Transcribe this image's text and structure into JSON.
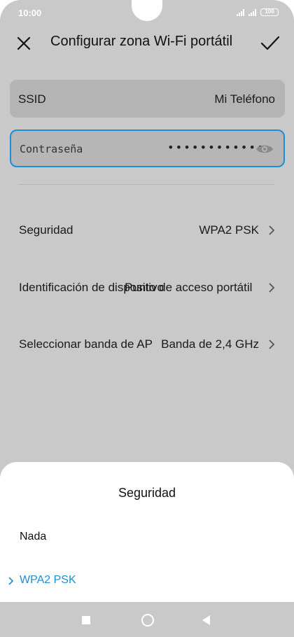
{
  "status": {
    "time": "10:00",
    "battery": "100"
  },
  "header": {
    "title": "Configurar zona Wi-Fi portátil",
    "close_icon": "close-icon",
    "confirm_icon": "check-icon"
  },
  "fields": {
    "ssid_label": "SSID",
    "ssid_value": "Mi Teléfono",
    "password_label": "Contraseña",
    "password_mask": "••••••••••••"
  },
  "rows": [
    {
      "label": "Seguridad",
      "value": "WPA2 PSK"
    },
    {
      "label": "Identificación de dispositivo",
      "value": "Punto de acceso portátil"
    },
    {
      "label": "Seleccionar banda de AP",
      "value": "Banda de 2,4 GHz"
    }
  ],
  "sheet": {
    "title": "Seguridad",
    "options": [
      {
        "label": "Nada",
        "selected": false
      },
      {
        "label": "WPA2 PSK",
        "selected": true
      }
    ]
  },
  "colors": {
    "accent": "#1a8fd6",
    "dim_background": "#c9c9c9"
  }
}
